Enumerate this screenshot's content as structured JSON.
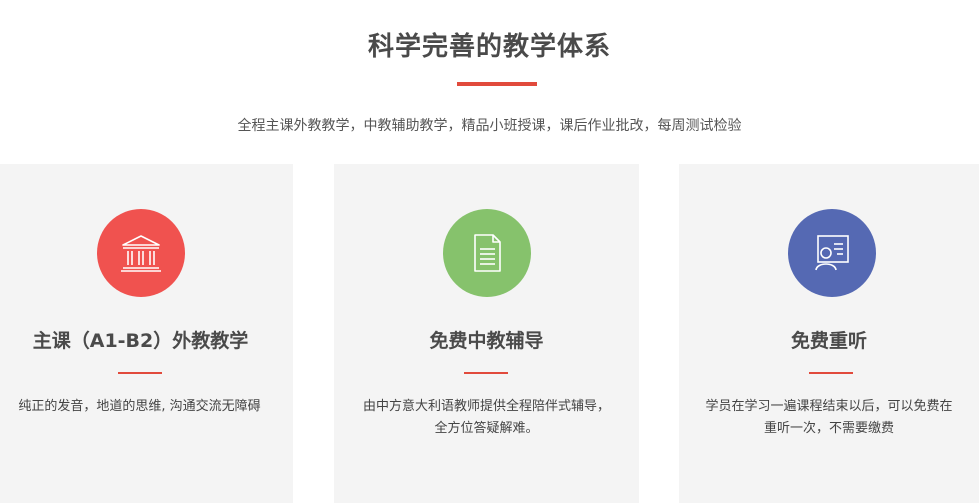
{
  "header": {
    "title": "科学完善的教学体系",
    "subtitle": "全程主课外教教学，中教辅助教学，精品小班授课，课后作业批改，每周测试检验"
  },
  "cards": [
    {
      "icon": "museum-icon",
      "color": "#f0524f",
      "title": "主课（A1-B2）外教教学",
      "desc_lines": [
        "纯正的发音，地道的思维, 沟通交流无障碍"
      ]
    },
    {
      "icon": "document-icon",
      "color": "#86c26c",
      "title": "免费中教辅导",
      "desc_lines": [
        "由中方意大利语教师提供全程陪伴式辅导，",
        "全方位答疑解难。"
      ]
    },
    {
      "icon": "teacher-board-icon",
      "color": "#5569b3",
      "title": "免费重听",
      "desc_lines": [
        "学员在学习一遍课程结束以后，可以免费在",
        "重听一次，不需要缴费"
      ]
    }
  ],
  "accent_color": "#e14a3c"
}
